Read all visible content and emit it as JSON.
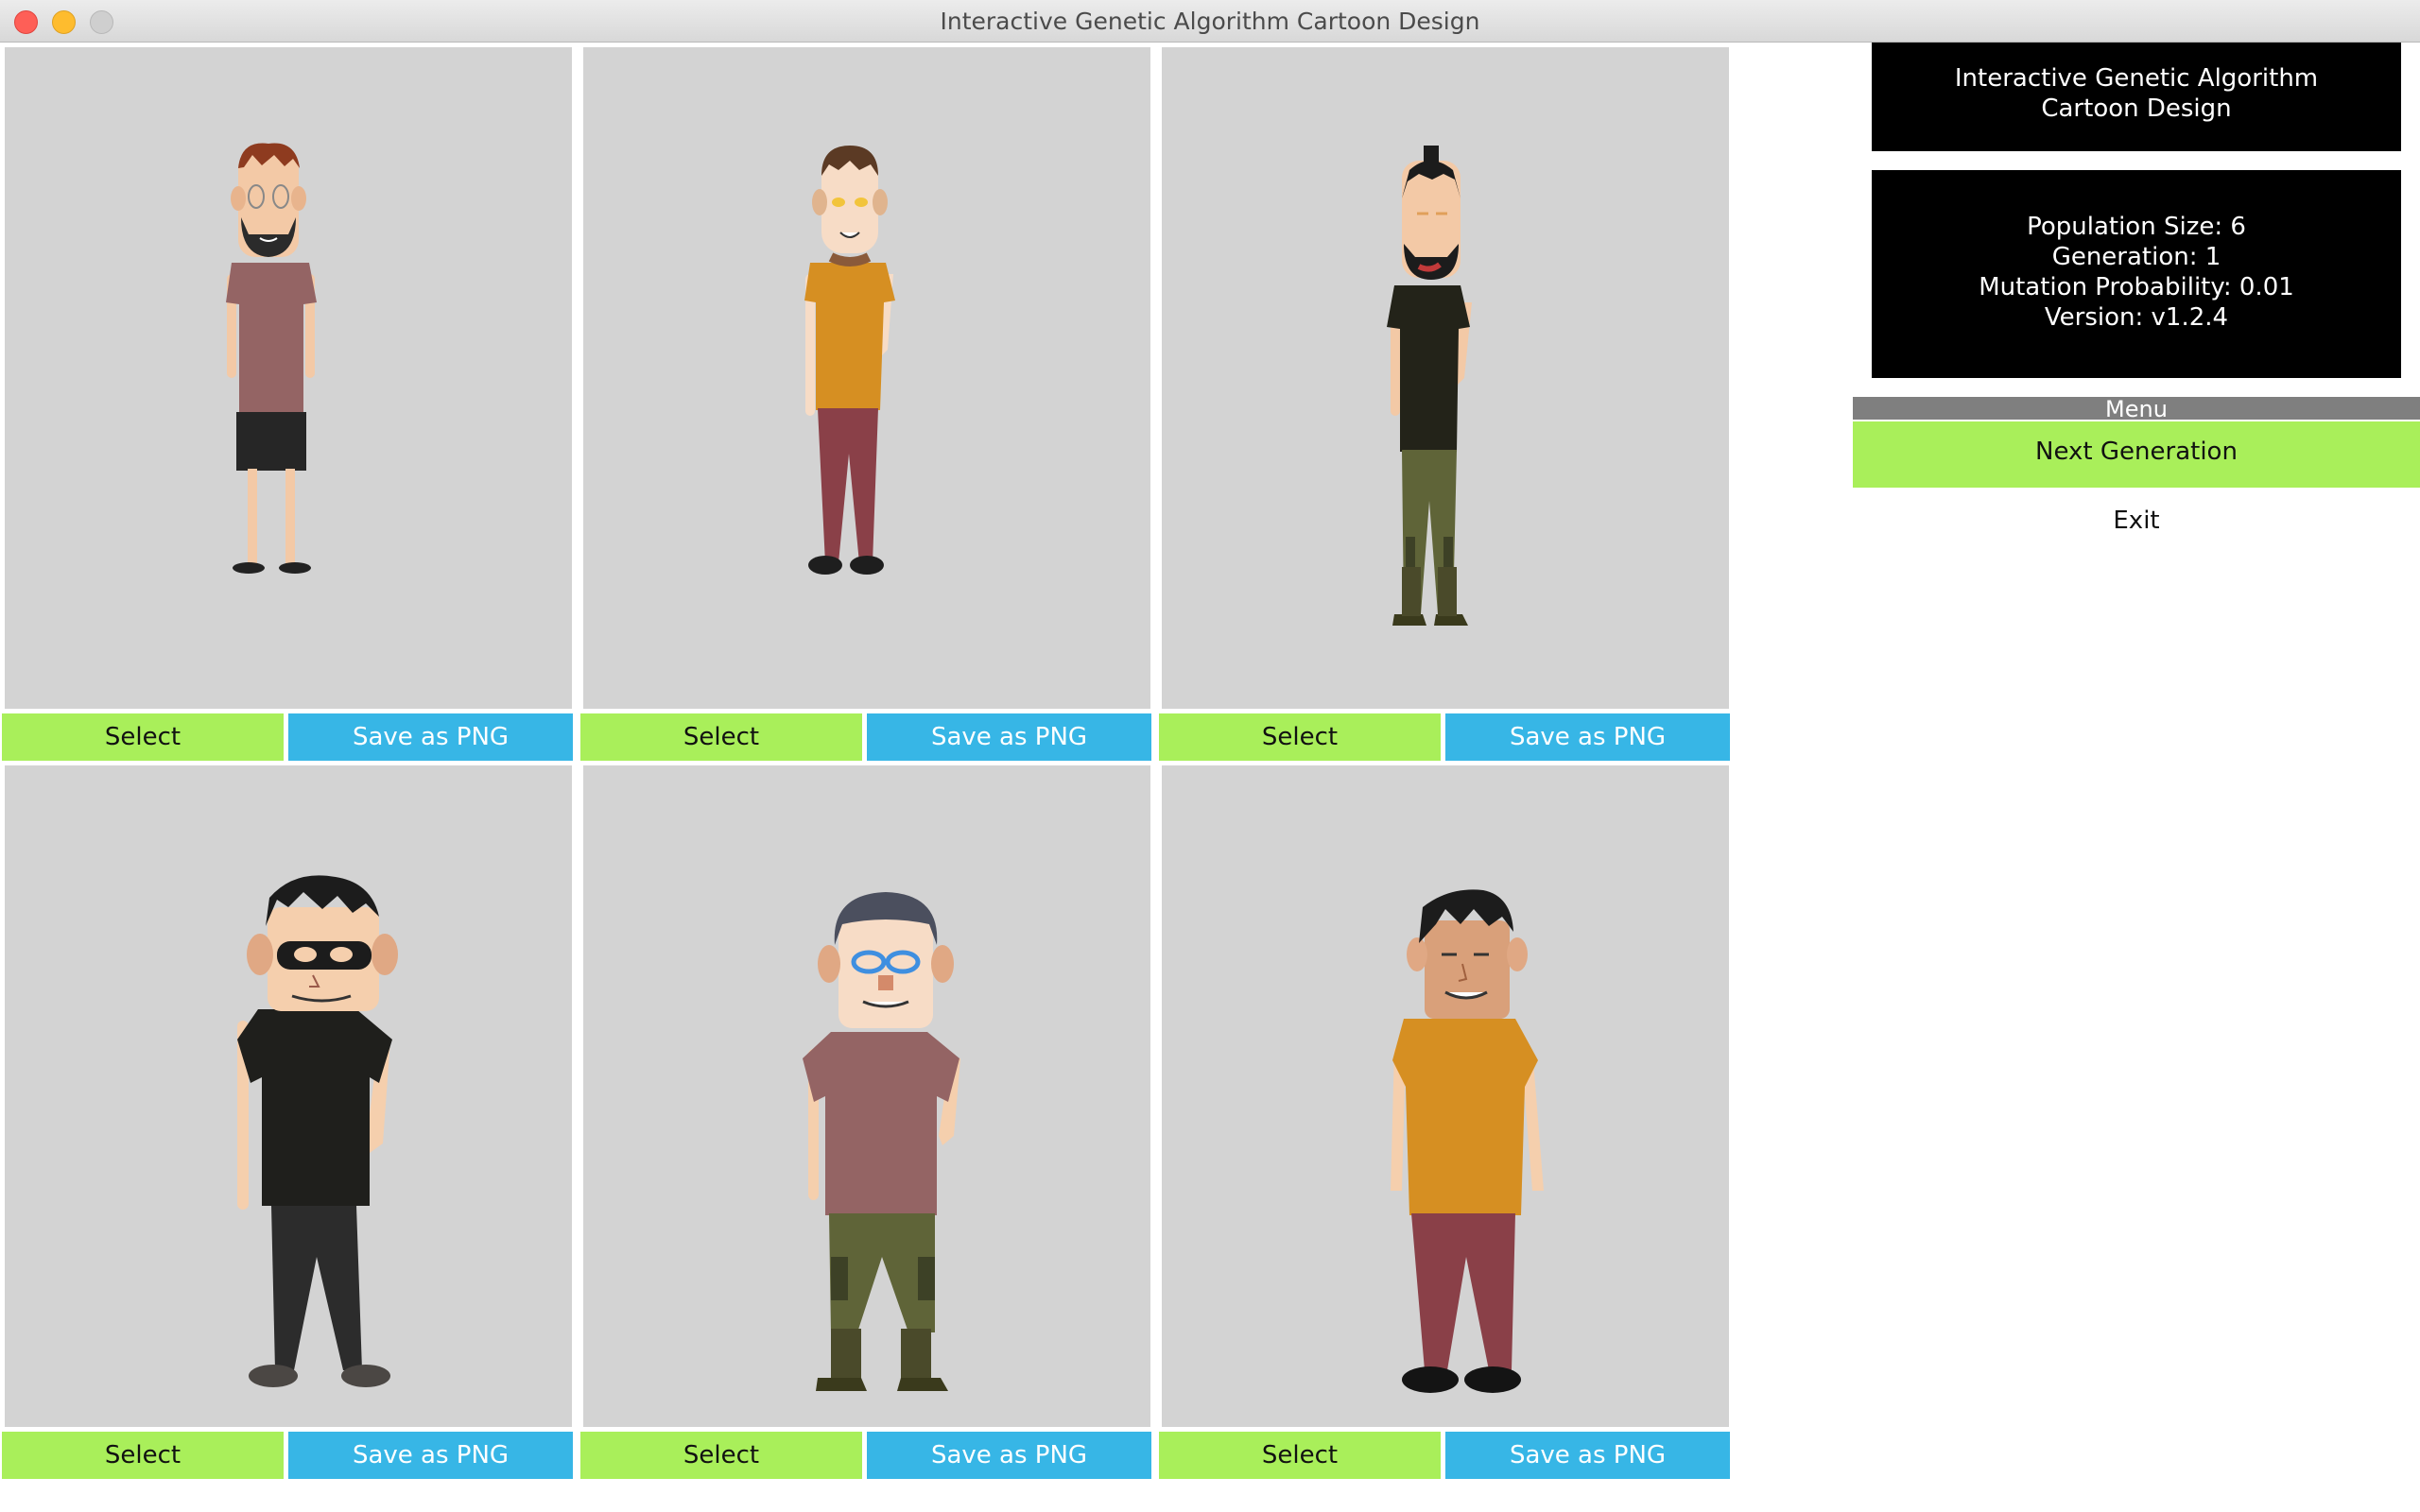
{
  "window": {
    "title": "Interactive Genetic Algorithm Cartoon Design"
  },
  "cells": [
    {
      "select_label": "Select",
      "save_label": "Save as PNG"
    },
    {
      "select_label": "Select",
      "save_label": "Save as PNG"
    },
    {
      "select_label": "Select",
      "save_label": "Save as PNG"
    },
    {
      "select_label": "Select",
      "save_label": "Save as PNG"
    },
    {
      "select_label": "Select",
      "save_label": "Save as PNG"
    },
    {
      "select_label": "Select",
      "save_label": "Save as PNG"
    }
  ],
  "panel": {
    "title_line1": "Interactive Genetic Algorithm",
    "title_line2": "Cartoon Design",
    "population": "Population Size: 6",
    "generation": "Generation: 1",
    "mutation": "Mutation Probability: 0.01",
    "version": "Version: v1.2.4"
  },
  "menu": {
    "header": "Menu",
    "next_label": "Next Generation",
    "exit_label": "Exit"
  },
  "colors": {
    "select_green": "#a9ef5a",
    "save_blue": "#37b6e6",
    "canvas_gray": "#d3d3d3"
  }
}
